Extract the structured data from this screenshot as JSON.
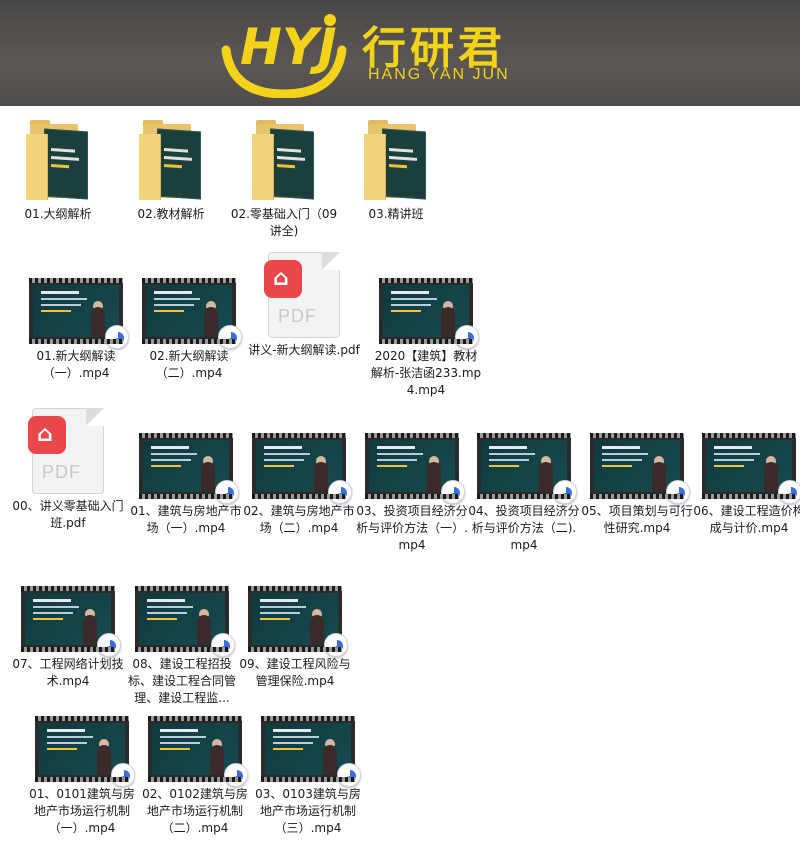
{
  "brand": {
    "cn": "行研君",
    "en": "HANG YAN JUN",
    "logo_text": "HYJ",
    "color": "#f3d21a"
  },
  "rows": [
    {
      "items": [
        {
          "type": "folder",
          "label": "01.大纲解析"
        },
        {
          "type": "folder",
          "label": "02.教材解析"
        },
        {
          "type": "folder",
          "label": "02.零基础入门（09讲全)"
        },
        {
          "type": "folder",
          "label": "03.精讲班"
        }
      ]
    },
    {
      "items": [
        {
          "type": "video",
          "label": "01.新大纲解读（一）.mp4"
        },
        {
          "type": "video",
          "label": "02.新大纲解读（二）.mp4"
        },
        {
          "type": "pdf",
          "label": "讲义-新大纲解读.pdf"
        },
        {
          "type": "video",
          "label": "2020【建筑】教材解析-张洁函233.mp4.mp4"
        }
      ]
    },
    {
      "items": [
        {
          "type": "pdf",
          "label": "00、讲义零基础入门班.pdf"
        },
        {
          "type": "video",
          "label": "01、建筑与房地产市场（一）.mp4"
        },
        {
          "type": "video",
          "label": "02、建筑与房地产市场（二）.mp4"
        },
        {
          "type": "video",
          "label": "03、投资项目经济分析与评价方法（一）.mp4"
        },
        {
          "type": "video",
          "label": "04、投资项目经济分析与评价方法（二).mp4"
        },
        {
          "type": "video",
          "label": "05、项目策划与可行性研究.mp4"
        },
        {
          "type": "video",
          "label": "06、建设工程造价构成与计价.mp4"
        }
      ]
    },
    {
      "items": [
        {
          "type": "video",
          "label": "07、工程网络计划技术.mp4"
        },
        {
          "type": "video",
          "label": "08、建设工程招投标、建设工程合同管理、建设工程监..."
        },
        {
          "type": "video",
          "label": "09、建设工程风险与管理保险.mp4"
        }
      ]
    },
    {
      "items": [
        {
          "type": "video",
          "label": "01、0101建筑与房地产市场运行机制（一）.mp4"
        },
        {
          "type": "video",
          "label": "02、0102建筑与房地产市场运行机制（二）.mp4"
        },
        {
          "type": "video",
          "label": "03、0103建筑与房地产市场运行机制（三）.mp4"
        }
      ]
    }
  ],
  "pdf_glyph": "PDF"
}
